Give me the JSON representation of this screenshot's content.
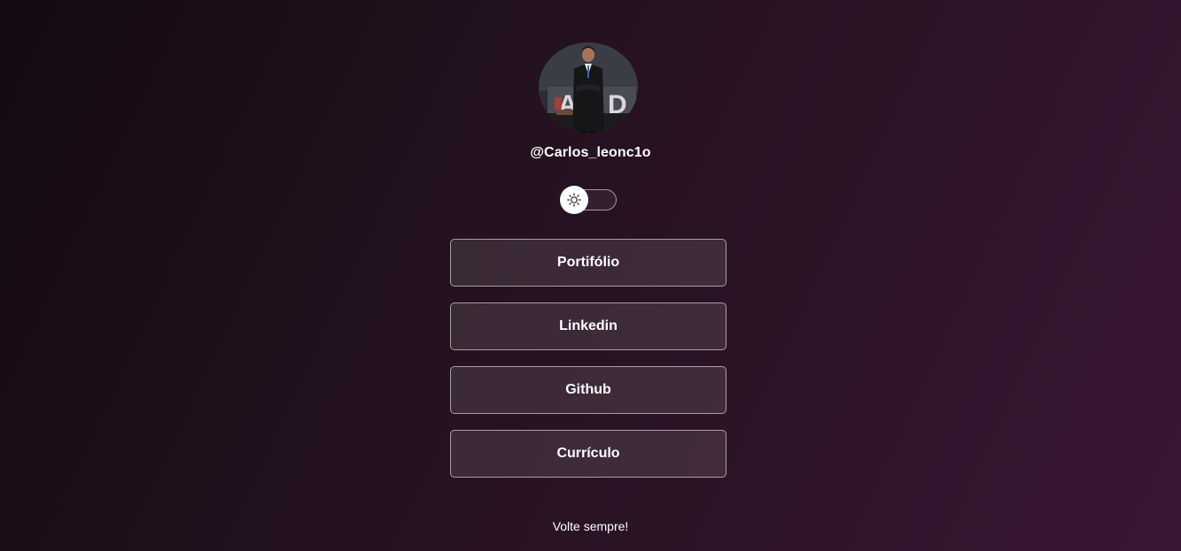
{
  "profile": {
    "username": "@Carlos_leonc1o",
    "avatar_icon": "profile-photo"
  },
  "theme_toggle": {
    "icon": "sun-icon",
    "state": "light"
  },
  "links": [
    {
      "label": "Portifólio"
    },
    {
      "label": "Linkedin"
    },
    {
      "label": "Github"
    },
    {
      "label": "Currículo"
    }
  ],
  "footer": {
    "text": "Volte sempre!"
  },
  "colors": {
    "background_start": "#150a12",
    "background_end": "#3a1735",
    "button_border": "#ffffff",
    "text": "#ffffff"
  }
}
